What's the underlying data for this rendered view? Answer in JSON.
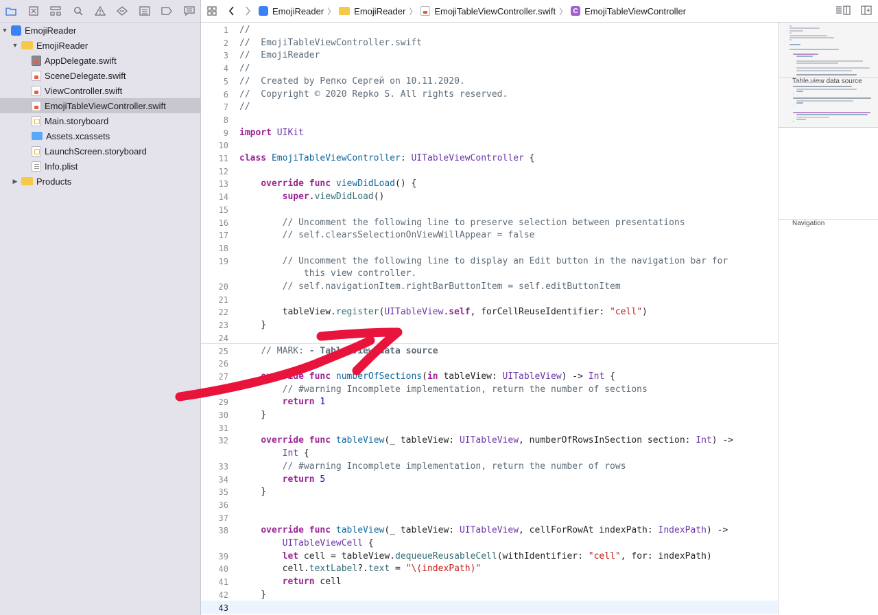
{
  "navigator": {
    "toolbar_icons": [
      "folder-icon",
      "source-control-icon",
      "hierarchy-icon",
      "search-icon",
      "warning-icon",
      "test-diamond-icon",
      "debug-list-icon",
      "breakpoint-icon",
      "report-icon"
    ],
    "tree": [
      {
        "label": "EmojiReader",
        "icon": "project-icon",
        "level": 0,
        "expanded": true,
        "selected": false
      },
      {
        "label": "EmojiReader",
        "icon": "folder-icon",
        "level": 1,
        "expanded": true,
        "selected": false
      },
      {
        "label": "AppDelegate.swift",
        "icon": "swift-file-icon",
        "level": 2,
        "selected": false
      },
      {
        "label": "SceneDelegate.swift",
        "icon": "swift-file-icon",
        "level": 2,
        "selected": false
      },
      {
        "label": "ViewController.swift",
        "icon": "swift-file-icon",
        "level": 2,
        "selected": false
      },
      {
        "label": "EmojiTableViewController.swift",
        "icon": "swift-file-icon",
        "level": 2,
        "selected": true
      },
      {
        "label": "Main.storyboard",
        "icon": "storyboard-icon",
        "level": 2,
        "selected": false
      },
      {
        "label": "Assets.xcassets",
        "icon": "assets-icon",
        "level": 2,
        "selected": false
      },
      {
        "label": "LaunchScreen.storyboard",
        "icon": "storyboard-icon",
        "level": 2,
        "selected": false
      },
      {
        "label": "Info.plist",
        "icon": "plist-icon",
        "level": 2,
        "selected": false
      },
      {
        "label": "Products",
        "icon": "folder-icon",
        "level": 1,
        "expanded": false,
        "selected": false
      }
    ]
  },
  "jumpbar": {
    "crumbs": [
      {
        "label": "EmojiReader",
        "icon": "project-icon"
      },
      {
        "label": "EmojiReader",
        "icon": "folder-icon"
      },
      {
        "label": "EmojiTableViewController.swift",
        "icon": "swift-file-icon"
      },
      {
        "label": "EmojiTableViewController",
        "icon": "class-icon",
        "glyph": "C"
      }
    ]
  },
  "editor": {
    "current_line": 43,
    "lines": [
      {
        "n": 1,
        "src": "//"
      },
      {
        "n": 2,
        "src": "//  EmojiTableViewController.swift"
      },
      {
        "n": 3,
        "src": "//  EmojiReader"
      },
      {
        "n": 4,
        "src": "//"
      },
      {
        "n": 5,
        "src": "//  Created by Репко Сергей on 10.11.2020."
      },
      {
        "n": 6,
        "src": "//  Copyright © 2020 Repko S. All rights reserved."
      },
      {
        "n": 7,
        "src": "//"
      },
      {
        "n": 8,
        "src": ""
      },
      {
        "n": 9,
        "src": "import UIKit"
      },
      {
        "n": 10,
        "src": ""
      },
      {
        "n": 11,
        "src": "class EmojiTableViewController: UITableViewController {"
      },
      {
        "n": 12,
        "src": ""
      },
      {
        "n": 13,
        "src": "    override func viewDidLoad() {"
      },
      {
        "n": 14,
        "src": "        super.viewDidLoad()"
      },
      {
        "n": 15,
        "src": ""
      },
      {
        "n": 16,
        "src": "        // Uncomment the following line to preserve selection between presentations"
      },
      {
        "n": 17,
        "src": "        // self.clearsSelectionOnViewWillAppear = false"
      },
      {
        "n": 18,
        "src": ""
      },
      {
        "n": 19,
        "src": "        // Uncomment the following line to display an Edit button in the navigation bar for",
        "cont": "            this view controller."
      },
      {
        "n": 20,
        "src": "        // self.navigationItem.rightBarButtonItem = self.editButtonItem"
      },
      {
        "n": 21,
        "src": ""
      },
      {
        "n": 22,
        "src": "        tableView.register(UITableView.self, forCellReuseIdentifier: \"cell\")"
      },
      {
        "n": 23,
        "src": "    }"
      },
      {
        "n": 24,
        "src": ""
      },
      {
        "n": 25,
        "src": "    // MARK: - Table view data source"
      },
      {
        "n": 26,
        "src": ""
      },
      {
        "n": 27,
        "src": "    override func numberOfSections(in tableView: UITableView) -> Int {"
      },
      {
        "n": 28,
        "src": "        // #warning Incomplete implementation, return the number of sections"
      },
      {
        "n": 29,
        "src": "        return 1"
      },
      {
        "n": 30,
        "src": "    }"
      },
      {
        "n": 31,
        "src": ""
      },
      {
        "n": 32,
        "src": "    override func tableView(_ tableView: UITableView, numberOfRowsInSection section: Int) ->",
        "cont": "        Int {"
      },
      {
        "n": 33,
        "src": "        // #warning Incomplete implementation, return the number of rows"
      },
      {
        "n": 34,
        "src": "        return 5"
      },
      {
        "n": 35,
        "src": "    }"
      },
      {
        "n": 36,
        "src": ""
      },
      {
        "n": 37,
        "src": ""
      },
      {
        "n": 38,
        "src": "    override func tableView(_ tableView: UITableView, cellForRowAt indexPath: IndexPath) ->",
        "cont": "        UITableViewCell {"
      },
      {
        "n": 39,
        "src": "        let cell = tableView.dequeueReusableCell(withIdentifier: \"cell\", for: indexPath)"
      },
      {
        "n": 40,
        "src": "        cell.textLabel?.text = \"\\(indexPath)\""
      },
      {
        "n": 41,
        "src": "        return cell"
      },
      {
        "n": 42,
        "src": "    }"
      },
      {
        "n": 43,
        "src": ""
      }
    ]
  },
  "minimap": {
    "labels": [
      "Table view data source",
      "Navigation"
    ]
  },
  "annotation": {
    "color": "#e8143c"
  }
}
